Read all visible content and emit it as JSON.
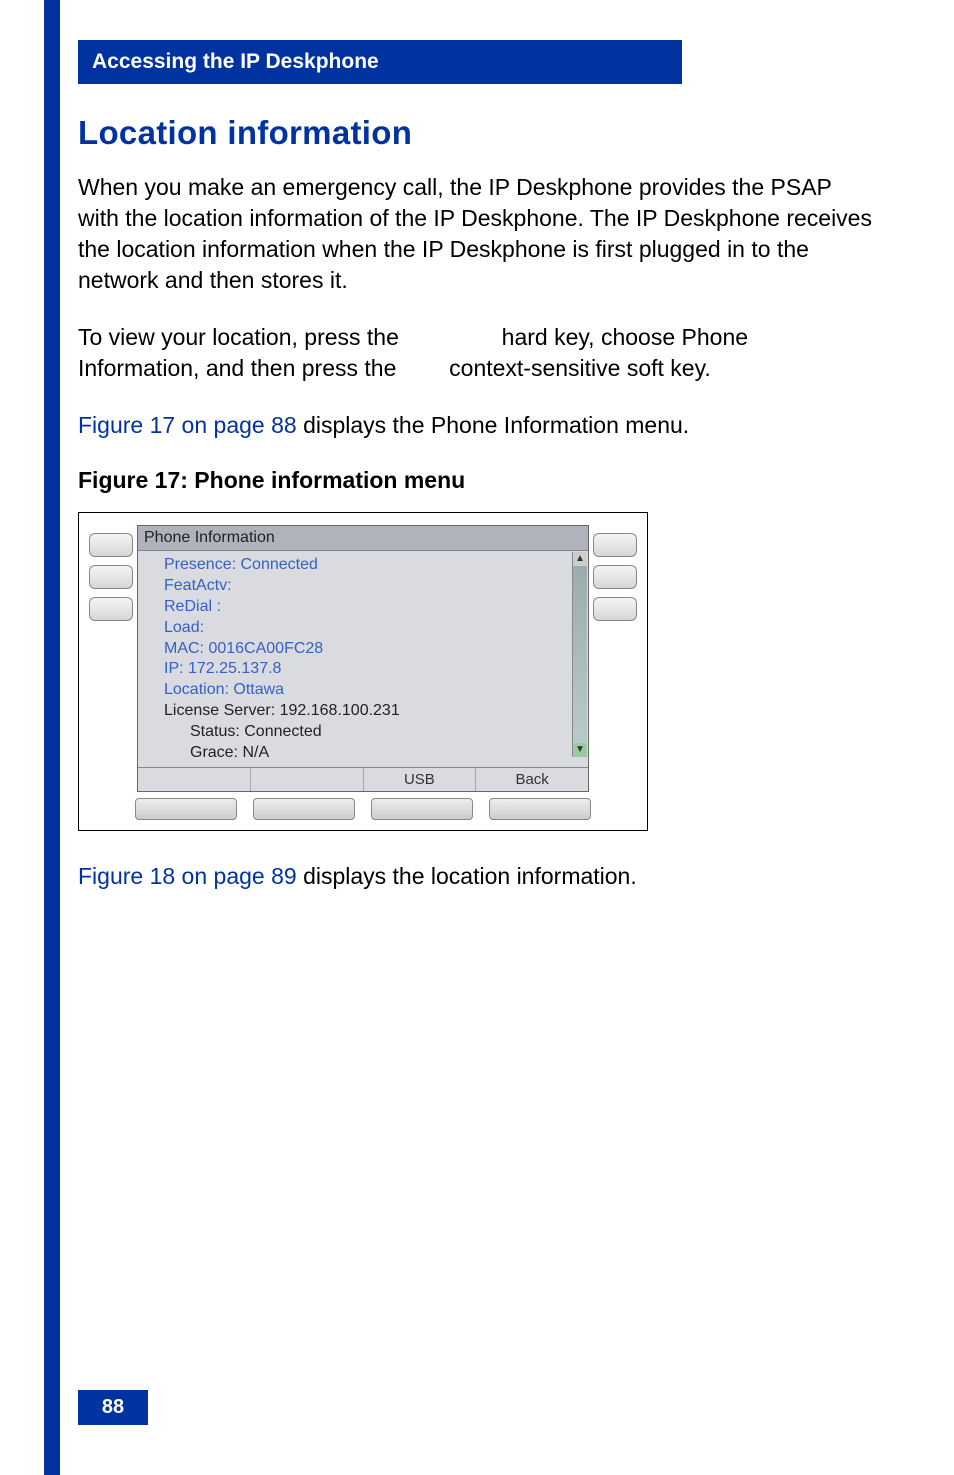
{
  "header": {
    "breadcrumb": "Accessing the IP Deskphone"
  },
  "section": {
    "title": "Location information",
    "paragraph1": "When you make an emergency call, the IP Deskphone provides the PSAP with the location information of the IP Deskphone. The IP Deskphone receives the location information when the IP Deskphone is first plugged in to the network and then stores it.",
    "paragraph2_part1": "To view your location, press the ",
    "paragraph2_part2": " hard key, choose Phone Information, and then press the ",
    "paragraph2_part3": " context-sensitive soft key.",
    "paragraph3_link": "Figure 17 on page 88",
    "paragraph3_rest": " displays the Phone Information menu.",
    "figure_caption": "Figure 17: Phone information menu",
    "paragraph4_link": "Figure 18 on page 89",
    "paragraph4_rest": " displays the location information."
  },
  "phone": {
    "screen_title": "Phone Information",
    "lines": [
      "Presence:  Connected",
      "FeatActv:",
      "ReDial :",
      "Load:",
      "MAC:  0016CA00FC28",
      "IP:  172.25.137.8",
      "Location:  Ottawa"
    ],
    "black_lines": [
      "License Server: 192.168.100.231",
      "Status: Connected",
      "Grace: N/A"
    ],
    "soft_labels": [
      "",
      "",
      "USB",
      "Back"
    ]
  },
  "footer": {
    "page_number": "88"
  }
}
